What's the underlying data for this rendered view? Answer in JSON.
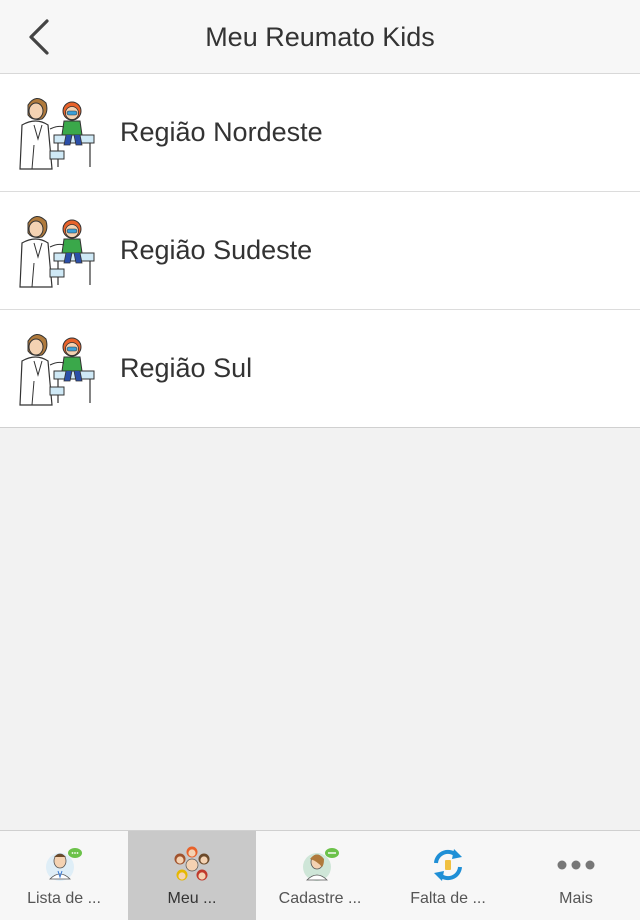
{
  "header": {
    "title": "Meu Reumato Kids",
    "back_icon": "chevron-left-icon"
  },
  "regions": [
    {
      "label": "Região Nordeste",
      "icon": "doctor-with-child-icon"
    },
    {
      "label": "Região Sudeste",
      "icon": "doctor-with-child-icon"
    },
    {
      "label": "Região Sul",
      "icon": "doctor-with-child-icon"
    }
  ],
  "tabbar": {
    "active_index": 1,
    "tabs": [
      {
        "label": "Lista de ...",
        "icon": "doctor-chat-icon"
      },
      {
        "label": "Meu ...",
        "icon": "kids-group-icon"
      },
      {
        "label": "Cadastre ...",
        "icon": "register-doctor-icon"
      },
      {
        "label": "Falta de ...",
        "icon": "sync-icon"
      },
      {
        "label": "Mais",
        "icon": "more-dots-icon"
      }
    ]
  },
  "colors": {
    "navbar_bg": "#f7f7f7",
    "page_bg": "#f2f2f2",
    "active_tab_bg": "#c9c9c9",
    "sync_blue": "#1f8fd6",
    "child_hair": "#e8622a"
  }
}
